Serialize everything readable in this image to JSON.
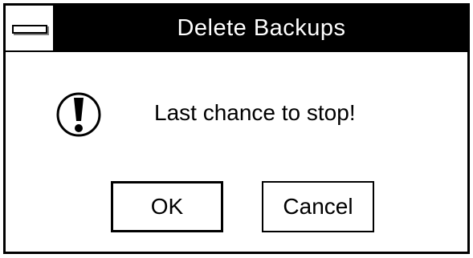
{
  "window": {
    "title": "Delete Backups"
  },
  "message": {
    "text": "Last chance to stop!",
    "icon": "exclamation-icon"
  },
  "buttons": {
    "ok_label": "OK",
    "cancel_label": "Cancel"
  },
  "colors": {
    "titlebar": "#000000",
    "title_text": "#ffffff",
    "background": "#ffffff",
    "border": "#000000"
  }
}
